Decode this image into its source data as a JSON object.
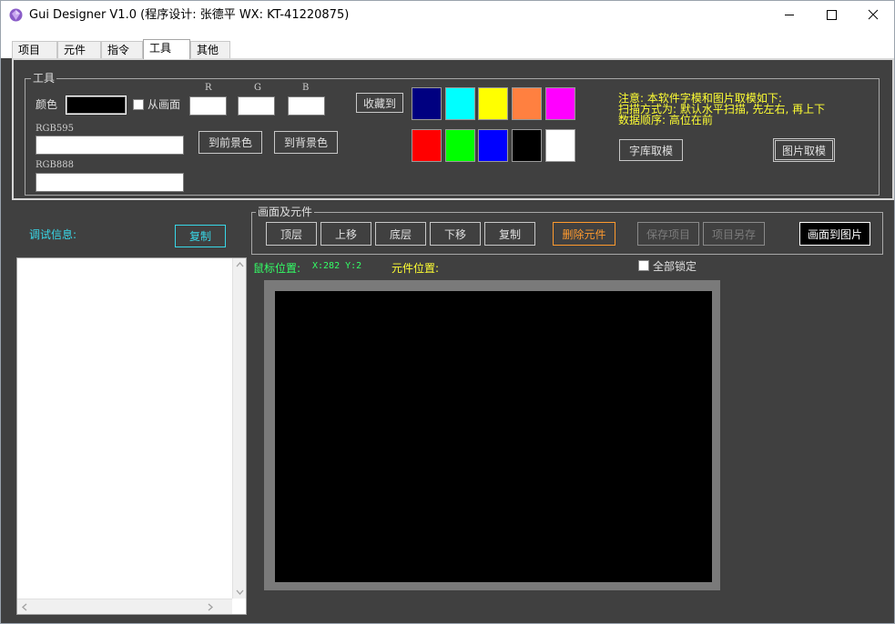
{
  "window": {
    "title": "Gui Designer V1.0 (程序设计: 张德平 WX: KT-41220875)",
    "icon": "purple-gem-icon"
  },
  "tabs": [
    {
      "label": "项目"
    },
    {
      "label": "元件"
    },
    {
      "label": "指令"
    },
    {
      "label": "工具",
      "active": true
    },
    {
      "label": "其他"
    }
  ],
  "tools": {
    "group_title": "工具",
    "color_label": "颜色",
    "from_screen_label": "从画面",
    "r_label": "R",
    "g_label": "G",
    "b_label": "B",
    "collect_button": "收藏到",
    "rgb595_label": "RGB595",
    "rgb888_label": "RGB888",
    "to_foreground_button": "到前景色",
    "to_background_button": "到背景色",
    "current_color": "#000000",
    "swatches": [
      "#000080",
      "#00ffff",
      "#ffff00",
      "#ff8040",
      "#ff00ff",
      "#ff0000",
      "#00ff00",
      "#0000ff",
      "#000000",
      "#ffffff"
    ],
    "notes": [
      "注意: 本软件字模和图片取模如下:",
      "扫描方式为: 默认水平扫描, 先左右, 再上下",
      "数据顺序: 高位在前"
    ],
    "font_extract_button": "字库取模",
    "image_extract_button": "图片取模"
  },
  "debug": {
    "label": "调试信息:",
    "copy_button": "复制"
  },
  "canvas_group": {
    "title": "画面及元件",
    "buttons": {
      "top": "顶层",
      "up": "上移",
      "bottom": "底层",
      "down": "下移",
      "copy": "复制",
      "delete": "删除元件",
      "save": "保存项目",
      "save_as": "项目另存",
      "to_image": "画面到图片"
    }
  },
  "status": {
    "mouse_label": "鼠标位置:",
    "mouse_value": "X:282 Y:2",
    "element_label": "元件位置:",
    "lock_all_label": "全部锁定"
  },
  "colors": {
    "panel": "#404040",
    "note": "#ffff33",
    "accent_cyan": "#38d8e8",
    "danger": "#ff9a2e",
    "mouse_pos": "#33ff66"
  }
}
